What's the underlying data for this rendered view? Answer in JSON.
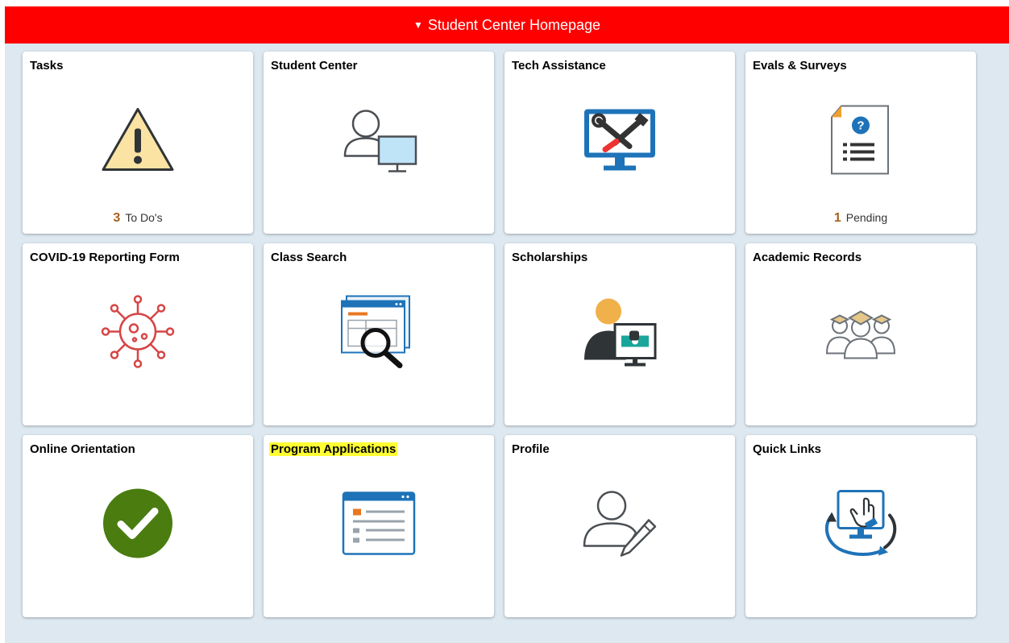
{
  "header": {
    "title": "Student Center Homepage",
    "collapse_icon": "caret-down-icon"
  },
  "tiles": [
    {
      "title": "Tasks",
      "icon": "warning-icon",
      "count": "3",
      "count_label": "To Do's"
    },
    {
      "title": "Student Center",
      "icon": "student-computer-icon"
    },
    {
      "title": "Tech Assistance",
      "icon": "tools-monitor-icon"
    },
    {
      "title": "Evals & Surveys",
      "icon": "survey-document-icon",
      "count": "1",
      "count_label": "Pending"
    },
    {
      "title": "COVID-19 Reporting Form",
      "icon": "virus-icon"
    },
    {
      "title": "Class Search",
      "icon": "search-window-icon"
    },
    {
      "title": "Scholarships",
      "icon": "scholarship-icon"
    },
    {
      "title": "Academic Records",
      "icon": "graduates-icon"
    },
    {
      "title": "Online Orientation",
      "icon": "checkmark-icon"
    },
    {
      "title": "Program Applications",
      "icon": "application-form-icon",
      "highlighted": true
    },
    {
      "title": "Profile",
      "icon": "profile-edit-icon"
    },
    {
      "title": "Quick Links",
      "icon": "monitor-click-icon"
    }
  ],
  "colors": {
    "header": "#ff0000",
    "background": "#dde8f1",
    "count_number": "#a8601e",
    "highlight": "#ffff33"
  }
}
